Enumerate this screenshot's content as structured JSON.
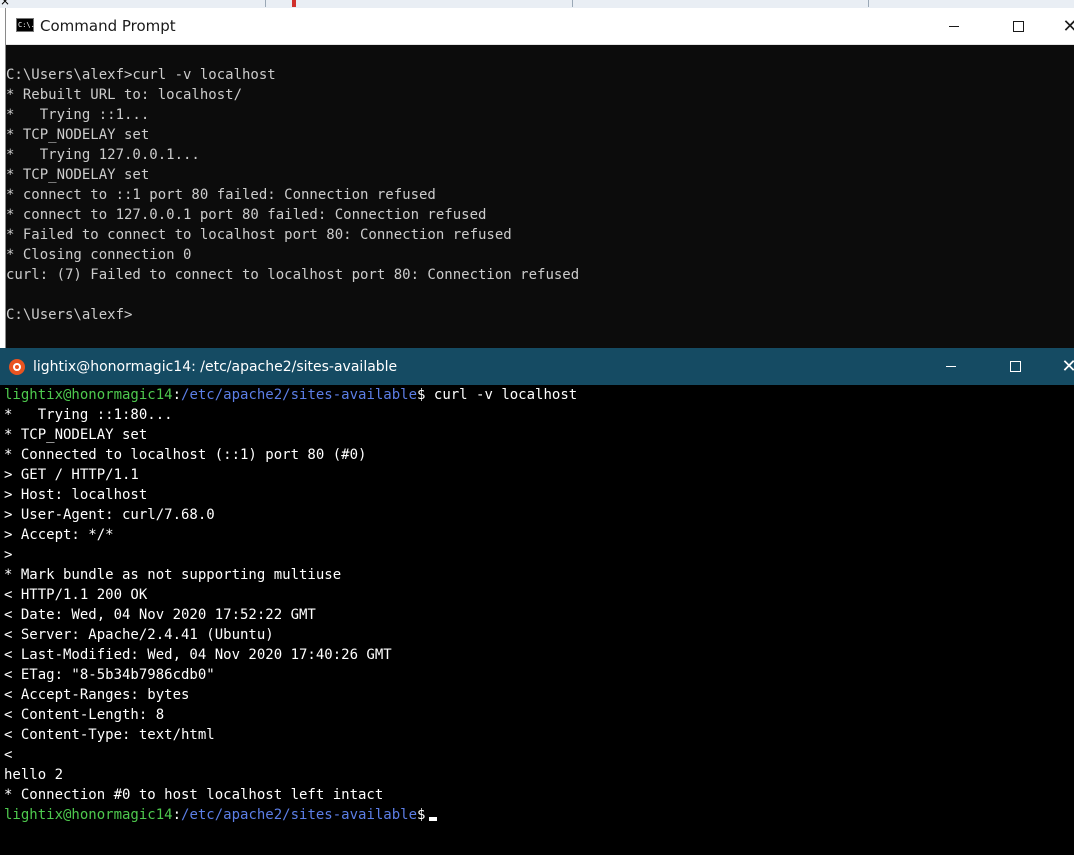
{
  "cmd_window": {
    "title": "Command Prompt",
    "icon_label": "C:\\.",
    "controls": {
      "minimize": "",
      "maximize": "",
      "close": "✕"
    },
    "lines": [
      "C:\\Users\\alexf>curl -v localhost",
      "* Rebuilt URL to: localhost/",
      "*   Trying ::1...",
      "* TCP_NODELAY set",
      "*   Trying 127.0.0.1...",
      "* TCP_NODELAY set",
      "* connect to ::1 port 80 failed: Connection refused",
      "* connect to 127.0.0.1 port 80 failed: Connection refused",
      "* Failed to connect to localhost port 80: Connection refused",
      "* Closing connection 0",
      "curl: (7) Failed to connect to localhost port 80: Connection refused",
      "",
      "C:\\Users\\alexf>"
    ]
  },
  "ubuntu_window": {
    "title": "lightix@honormagic14: /etc/apache2/sites-available",
    "controls": {
      "minimize": "",
      "maximize": "",
      "close": "✕"
    },
    "prompt": {
      "user_host": "lightix@honormagic14",
      "separator": ":",
      "path": "/etc/apache2/sites-available",
      "symbol": "$"
    },
    "command": " curl -v localhost",
    "lines": [
      "*   Trying ::1:80...",
      "* TCP_NODELAY set",
      "* Connected to localhost (::1) port 80 (#0)",
      "> GET / HTTP/1.1",
      "> Host: localhost",
      "> User-Agent: curl/7.68.0",
      "> Accept: */*",
      ">",
      "* Mark bundle as not supporting multiuse",
      "< HTTP/1.1 200 OK",
      "< Date: Wed, 04 Nov 2020 17:52:22 GMT",
      "< Server: Apache/2.4.41 (Ubuntu)",
      "< Last-Modified: Wed, 04 Nov 2020 17:40:26 GMT",
      "< ETag: \"8-5b34b7986cdb0\"",
      "< Accept-Ranges: bytes",
      "< Content-Length: 8",
      "< Content-Type: text/html",
      "<",
      "hello 2",
      "* Connection #0 to host localhost left intact"
    ],
    "colors": {
      "prompt_user": "#4ec94e",
      "prompt_path": "#5c7ee6",
      "titlebar": "#154b63",
      "icon": "#e95420"
    }
  },
  "top_strip": {
    "close_glyph": "×"
  }
}
